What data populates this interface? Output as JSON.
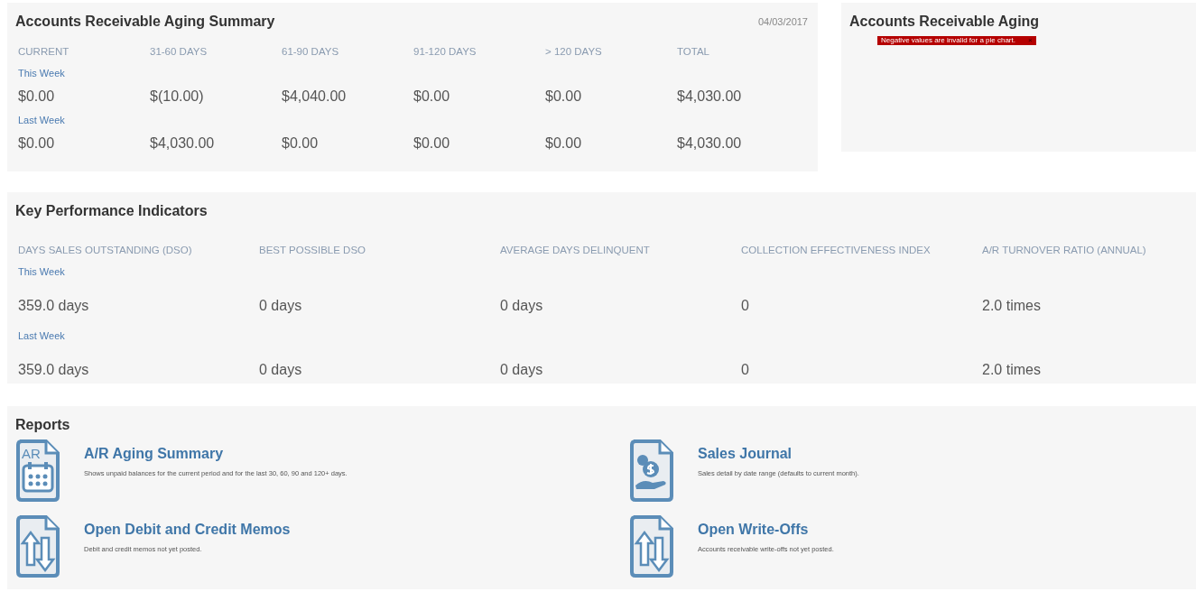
{
  "aging_summary": {
    "title": "Accounts Receivable Aging Summary",
    "date": "04/03/2017",
    "columns": [
      "CURRENT",
      "31-60 DAYS",
      "61-90 DAYS",
      "91-120 DAYS",
      "> 120 DAYS",
      "TOTAL"
    ],
    "periods": [
      {
        "label": "This Week",
        "values": [
          "$0.00",
          "$(10.00)",
          "$4,040.00",
          "$0.00",
          "$0.00",
          "$4,030.00"
        ]
      },
      {
        "label": "Last Week",
        "values": [
          "$0.00",
          "$4,030.00",
          "$0.00",
          "$0.00",
          "$0.00",
          "$4,030.00"
        ]
      }
    ]
  },
  "aging_chart": {
    "title": "Accounts Receivable Aging",
    "error": "Negative values are invalid for a pie chart.",
    "error_close": "×"
  },
  "kpi": {
    "title": "Key Performance Indicators",
    "columns": [
      "DAYS SALES OUTSTANDING (DSO)",
      "BEST POSSIBLE DSO",
      "AVERAGE DAYS DELINQUENT",
      "COLLECTION EFFECTIVENESS INDEX",
      "A/R TURNOVER RATIO (ANNUAL)"
    ],
    "periods": [
      {
        "label": "This Week",
        "values": [
          "359.0 days",
          "0 days",
          "0 days",
          "0",
          "2.0 times"
        ]
      },
      {
        "label": "Last Week",
        "values": [
          "359.0 days",
          "0 days",
          "0 days",
          "0",
          "2.0 times"
        ]
      }
    ]
  },
  "reports": {
    "title": "Reports",
    "items": [
      {
        "kind": "calendar",
        "icon_text": "AR",
        "title": "A/R Aging Summary",
        "description": "Shows unpaid balances for the current period and for the last 30, 60, 90 and 120+ days."
      },
      {
        "kind": "money",
        "title": "Sales Journal",
        "description": "Sales detail by date range (defaults to current month)."
      },
      {
        "kind": "arrows",
        "title": "Open Debit and Credit Memos",
        "description": "Debit and credit memos not yet posted."
      },
      {
        "kind": "arrows",
        "title": "Open Write-Offs",
        "description": "Accounts receivable write-offs not yet posted."
      }
    ]
  }
}
